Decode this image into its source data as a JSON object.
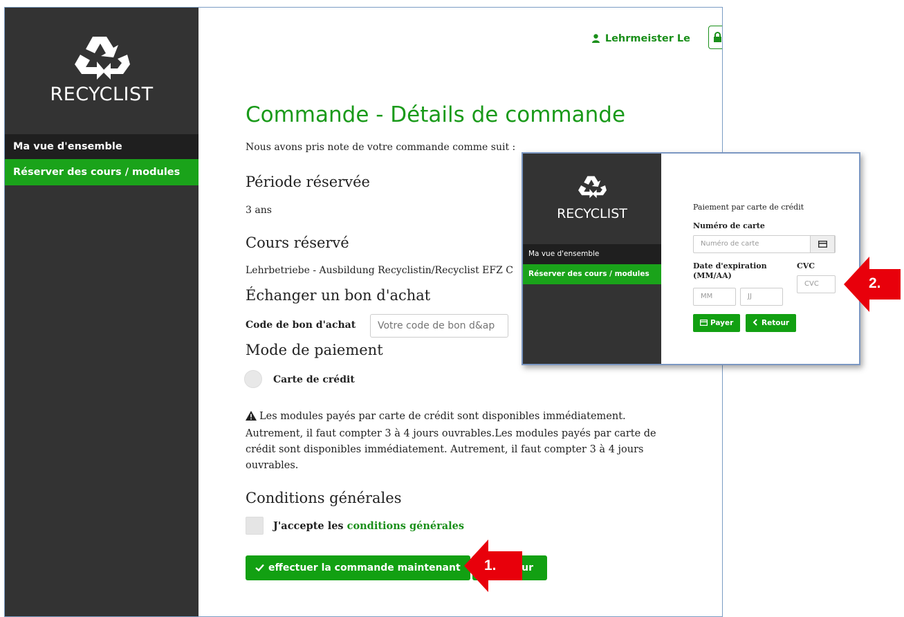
{
  "app": {
    "logo_text": "RECYCLIST",
    "accent_color": "#1aa31a",
    "sidebar_color": "#333333"
  },
  "sidebar": {
    "items": [
      {
        "label": "Ma vue d'ensemble",
        "active": false
      },
      {
        "label": "Réserver des cours / modules",
        "active": true
      }
    ]
  },
  "header": {
    "user_label": "Lehrmeister Le",
    "user_icon": "user-icon",
    "logout_icon": "lock-icon"
  },
  "order": {
    "title": "Commande - Détails de commande",
    "intro": "Nous avons pris note de votre commande comme suit :",
    "period_heading": "Période réservée",
    "period_value": "3 ans",
    "course_heading": "Cours réservé",
    "course_value": "Lehrbetriebe - Ausbildung Recyclistin/Recyclist EFZ C",
    "voucher_heading": "Échanger un bon d'achat",
    "voucher_label": "Code de bon d'achat",
    "voucher_placeholder": "Votre code de bon d&ap",
    "payment_heading": "Mode de paiement",
    "payment_option": "Carte de crédit",
    "warning": "Les modules payés par carte de crédit sont disponibles immédiatement. Autrement, il faut compter 3 à 4 jours ouvrables.Les modules payés par carte de crédit sont disponibles immédiatement. Autrement, il faut compter 3 à 4 jours ouvrables.",
    "terms_heading": "Conditions générales",
    "terms_prefix": "J'accepte les ",
    "terms_link": "conditions générales",
    "order_button": "effectuer la commande maintenant",
    "back_button_partial": "ur"
  },
  "payment_window": {
    "logo_text": "RECYCLIST",
    "nav": [
      "Ma vue d'ensemble",
      "Réserver des cours / modules"
    ],
    "title": "Paiement par carte de crédit",
    "card_label": "Numéro de carte",
    "card_placeholder": "Numéro de carte",
    "expiry_label": "Date d'expiration (MM/AA)",
    "month_placeholder": "MM",
    "day_placeholder": "JJ",
    "cvc_label": "CVC",
    "cvc_placeholder": "CVC",
    "pay_button": "Payer",
    "return_button": "Retour"
  },
  "annotations": {
    "step1": "1.",
    "step2": "2.",
    "arrow_color": "#e8000b"
  }
}
